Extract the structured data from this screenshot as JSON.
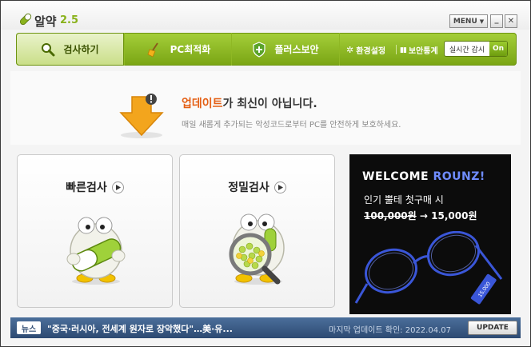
{
  "app": {
    "title": "알약",
    "version": "2.5"
  },
  "window_controls": {
    "menu_label": "MENU",
    "minimize": "_",
    "close": "✕"
  },
  "toolbar": {
    "tabs": [
      {
        "label": "검사하기",
        "icon": "search-icon"
      },
      {
        "label": "PC최적화",
        "icon": "broom-icon"
      },
      {
        "label": "플러스보안",
        "icon": "shield-plus-icon"
      }
    ],
    "settings_label": "환경설정",
    "security_stats_label": "보안통계",
    "realtime_label": "실시간 감시",
    "realtime_state": "On"
  },
  "status": {
    "title_highlight": "업데이트",
    "title_rest": "가 최신이 아닙니다.",
    "subtitle": "매일 새롭게 추가되는 악성코드로부터 PC를 안전하게 보호하세요."
  },
  "cards": {
    "quick_scan": "빠른검사",
    "deep_scan": "정밀검사"
  },
  "ad": {
    "title_a": "WELCOME",
    "title_b": "ROUNZ!",
    "subtitle": "인기 뿔테 첫구매 시",
    "old_price": "100,000원",
    "arrow": "→",
    "new_price": "15,000원",
    "tag": "15,000"
  },
  "news": {
    "badge": "뉴스",
    "headline": "\"중국·러시아, 전세계 원자로 장악했다\"…美·유...",
    "last_update_label": "마지막 업데이트 확인:",
    "last_update_date": "2022.04.07",
    "update_button": "UPDATE"
  },
  "colors": {
    "accent_green": "#8ab21c",
    "highlight_orange": "#e45f14",
    "news_blue": "#2d4a72"
  }
}
